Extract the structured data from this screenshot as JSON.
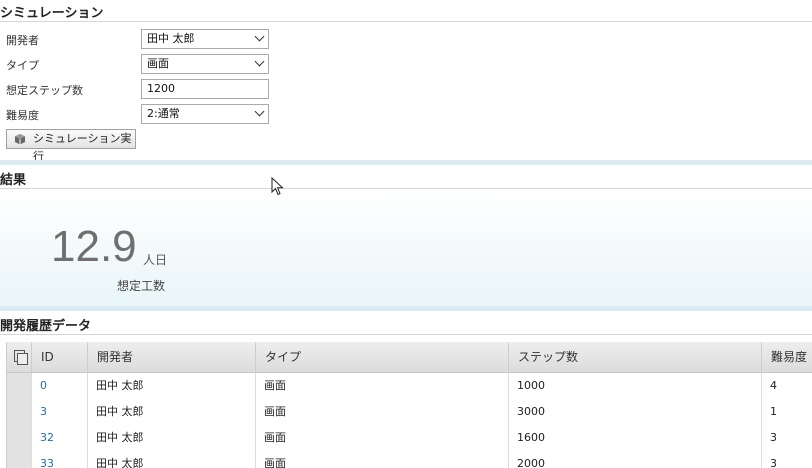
{
  "simulation": {
    "title": "シミュレーション",
    "fields": [
      {
        "label": "開発者",
        "value": "田中 太郎",
        "kind": "select"
      },
      {
        "label": "タイプ",
        "value": "画面",
        "kind": "select"
      },
      {
        "label": "想定ステップ数",
        "value": "1200",
        "kind": "input"
      },
      {
        "label": "難易度",
        "value": "2:通常",
        "kind": "select"
      }
    ],
    "run_button": "シミュレーション実行"
  },
  "result": {
    "title": "結果",
    "value": "12.9",
    "unit": "人日",
    "caption": "想定工数"
  },
  "history": {
    "title": "開発履歴データ",
    "columns": [
      "ID",
      "開発者",
      "タイプ",
      "ステップ数",
      "難易度"
    ],
    "rows": [
      [
        "0",
        "田中 太郎",
        "画面",
        "1000",
        "4"
      ],
      [
        "3",
        "田中 太郎",
        "画面",
        "3000",
        "1"
      ],
      [
        "32",
        "田中 太郎",
        "画面",
        "1600",
        "3"
      ],
      [
        "33",
        "田中 太郎",
        "画面",
        "2000",
        "3"
      ]
    ]
  },
  "colors": {
    "accent_band": "#dceaf1",
    "link": "#1f6fb5"
  }
}
